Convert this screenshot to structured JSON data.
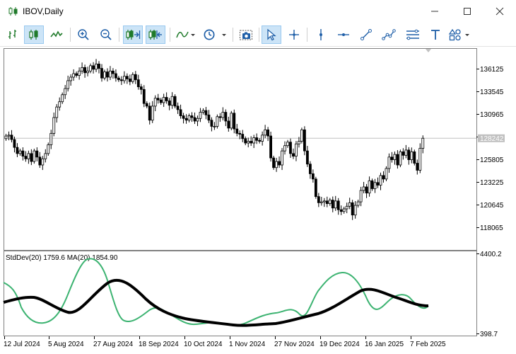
{
  "window": {
    "title": "IBOV,Daily",
    "minimize_icon": "minimize-icon",
    "maximize_icon": "maximize-icon",
    "close_icon": "close-icon"
  },
  "toolbar": {
    "buttons": [
      {
        "name": "bar-chart-button",
        "icon": "bar-chart-icon",
        "active": false
      },
      {
        "name": "candlestick-button",
        "icon": "candlestick-icon",
        "active": true
      },
      {
        "name": "line-chart-button",
        "icon": "line-chart-icon",
        "active": false
      },
      {
        "name": "zoom-in-button",
        "icon": "zoom-in-icon",
        "active": false
      },
      {
        "name": "zoom-out-button",
        "icon": "zoom-out-icon",
        "active": false
      },
      {
        "name": "auto-scroll-button",
        "icon": "auto-scroll-icon",
        "active": true
      },
      {
        "name": "chart-shift-button",
        "icon": "chart-shift-icon",
        "active": true
      },
      {
        "name": "indicators-button",
        "icon": "indicators-icon",
        "active": false
      },
      {
        "name": "periods-button",
        "icon": "clock-icon",
        "active": false
      },
      {
        "name": "screenshot-button",
        "icon": "camera-icon",
        "active": false
      },
      {
        "name": "cursor-button",
        "icon": "cursor-icon",
        "active": true
      },
      {
        "name": "crosshair-button",
        "icon": "crosshair-icon",
        "active": false
      },
      {
        "name": "vertical-line-button",
        "icon": "vertical-line-icon",
        "active": false
      },
      {
        "name": "horizontal-line-button",
        "icon": "horizontal-line-icon",
        "active": false
      },
      {
        "name": "trendline-button",
        "icon": "trendline-icon",
        "active": false
      },
      {
        "name": "equidistant-channel-button",
        "icon": "channel-icon",
        "active": false
      },
      {
        "name": "fibonacci-button",
        "icon": "fibonacci-icon",
        "active": false
      },
      {
        "name": "text-button",
        "icon": "text-icon",
        "active": false
      },
      {
        "name": "shapes-button",
        "icon": "shapes-icon",
        "active": false
      }
    ]
  },
  "chart": {
    "price_labels": [
      "136125",
      "133545",
      "130965",
      "128385",
      "125805",
      "123225",
      "120645",
      "118065"
    ],
    "current_price_label": "128242",
    "indicator_label": "StdDev(20) 1759.6 MA(20) 1854.90",
    "indicator_max": "4400.2",
    "indicator_min": "398.7",
    "date_labels": [
      "12 Jul 2024",
      "5 Aug 2024",
      "27 Aug 2024",
      "18 Sep 2024",
      "10 Oct 2024",
      "1 Nov 2024",
      "27 Nov 2024",
      "19 Dec 2024",
      "16 Jan 2025",
      "7 Feb 2025"
    ],
    "colors": {
      "bull_candle": "#ffffff",
      "bear_candle": "#000000",
      "stddev_line": "#3cb371",
      "ma_line": "#000000",
      "current_price_line": "#c0c0c0"
    }
  },
  "chart_data": {
    "type": "candlestick",
    "symbol": "IBOV",
    "timeframe": "Daily",
    "price_axis_ticks": [
      136125,
      133545,
      130965,
      128385,
      125805,
      123225,
      120645,
      118065
    ],
    "current_price": 128242,
    "close_series": [
      128500,
      128600,
      128100,
      127200,
      126500,
      126800,
      126200,
      125900,
      126500,
      125600,
      126800,
      126100,
      125200,
      125900,
      126500,
      127500,
      128800,
      130600,
      131800,
      132400,
      133200,
      133900,
      134800,
      135200,
      135600,
      135400,
      135900,
      136300,
      135700,
      135900,
      136500,
      136100,
      136700,
      136200,
      135100,
      135800,
      135200,
      135900,
      135600,
      135100,
      134900,
      134800,
      135300,
      135000,
      134700,
      135500,
      134900,
      134100,
      133800,
      132200,
      131900,
      130300,
      131900,
      132800,
      132600,
      132300,
      132900,
      132500,
      132000,
      133000,
      131900,
      131500,
      130800,
      130500,
      130300,
      130800,
      130600,
      130200,
      130500,
      131200,
      131400,
      130900,
      130300,
      129600,
      129600,
      130700,
      130600,
      131200,
      130200,
      129400,
      131100,
      129300,
      128800,
      128700,
      128200,
      127700,
      127900,
      127700,
      128300,
      128000,
      127900,
      128600,
      129200,
      128500,
      126000,
      124900,
      125600,
      125200,
      126800,
      127400,
      127800,
      126500,
      126200,
      127600,
      127900,
      129200,
      126800,
      125300,
      124200,
      123600,
      121600,
      120900,
      121000,
      121100,
      120800,
      121200,
      120300,
      121100,
      120100,
      119900,
      120200,
      120500,
      120900,
      119500,
      120600,
      121000,
      122300,
      122700,
      122000,
      123400,
      122500,
      123200,
      122900,
      124000,
      123600,
      124800,
      126100,
      125800,
      126400,
      125200,
      126700,
      126300,
      126900,
      125800,
      126700,
      125400,
      124600,
      127100,
      128242
    ],
    "indicator": {
      "name": "StdDev(20)",
      "stddev_value": 1759.6,
      "ma_name": "MA(20)",
      "ma_value": 1854.9,
      "ylim": [
        398.7,
        4400.2
      ]
    },
    "x_axis_dates": [
      "12 Jul 2024",
      "5 Aug 2024",
      "27 Aug 2024",
      "18 Sep 2024",
      "10 Oct 2024",
      "1 Nov 2024",
      "27 Nov 2024",
      "19 Dec 2024",
      "16 Jan 2025",
      "7 Feb 2025"
    ]
  }
}
